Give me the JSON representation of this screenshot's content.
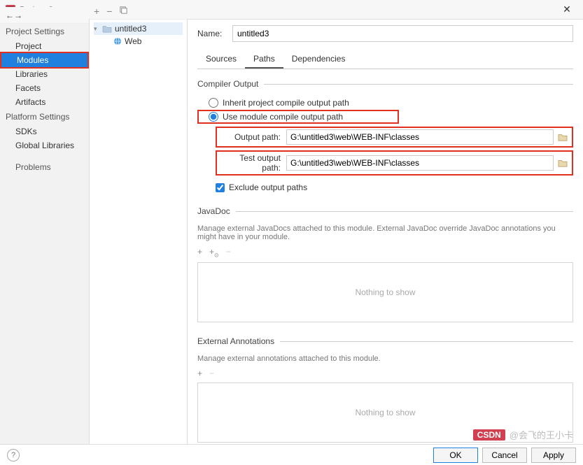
{
  "window": {
    "title": "Project Structure"
  },
  "sidebar": {
    "section1_label": "Project Settings",
    "items1": [
      "Project",
      "Modules",
      "Libraries",
      "Facets",
      "Artifacts"
    ],
    "selected": "Modules",
    "section2_label": "Platform Settings",
    "items2": [
      "SDKs",
      "Global Libraries"
    ],
    "section3_label": "Problems"
  },
  "tree": {
    "root": "untitled3",
    "child": "Web"
  },
  "form": {
    "name_label": "Name:",
    "name_value": "untitled3",
    "tabs": [
      "Sources",
      "Paths",
      "Dependencies"
    ],
    "active_tab": "Paths"
  },
  "compiler": {
    "legend": "Compiler Output",
    "radio_inherit": "Inherit project compile output path",
    "radio_module": "Use module compile output path",
    "output_label": "Output path:",
    "output_value": "G:\\untitled3\\web\\WEB-INF\\classes",
    "test_label": "Test output path:",
    "test_value": "G:\\untitled3\\web\\WEB-INF\\classes",
    "exclude_label": "Exclude output paths"
  },
  "javadoc": {
    "legend": "JavaDoc",
    "desc": "Manage external JavaDocs attached to this module. External JavaDoc override JavaDoc annotations you might have in your module.",
    "empty": "Nothing to show"
  },
  "annotations": {
    "legend": "External Annotations",
    "desc": "Manage external annotations attached to this module.",
    "empty": "Nothing to show"
  },
  "footer": {
    "ok": "OK",
    "cancel": "Cancel",
    "apply": "Apply"
  },
  "watermark": {
    "badge": "CSDN",
    "text": "@会飞的王小卡"
  }
}
